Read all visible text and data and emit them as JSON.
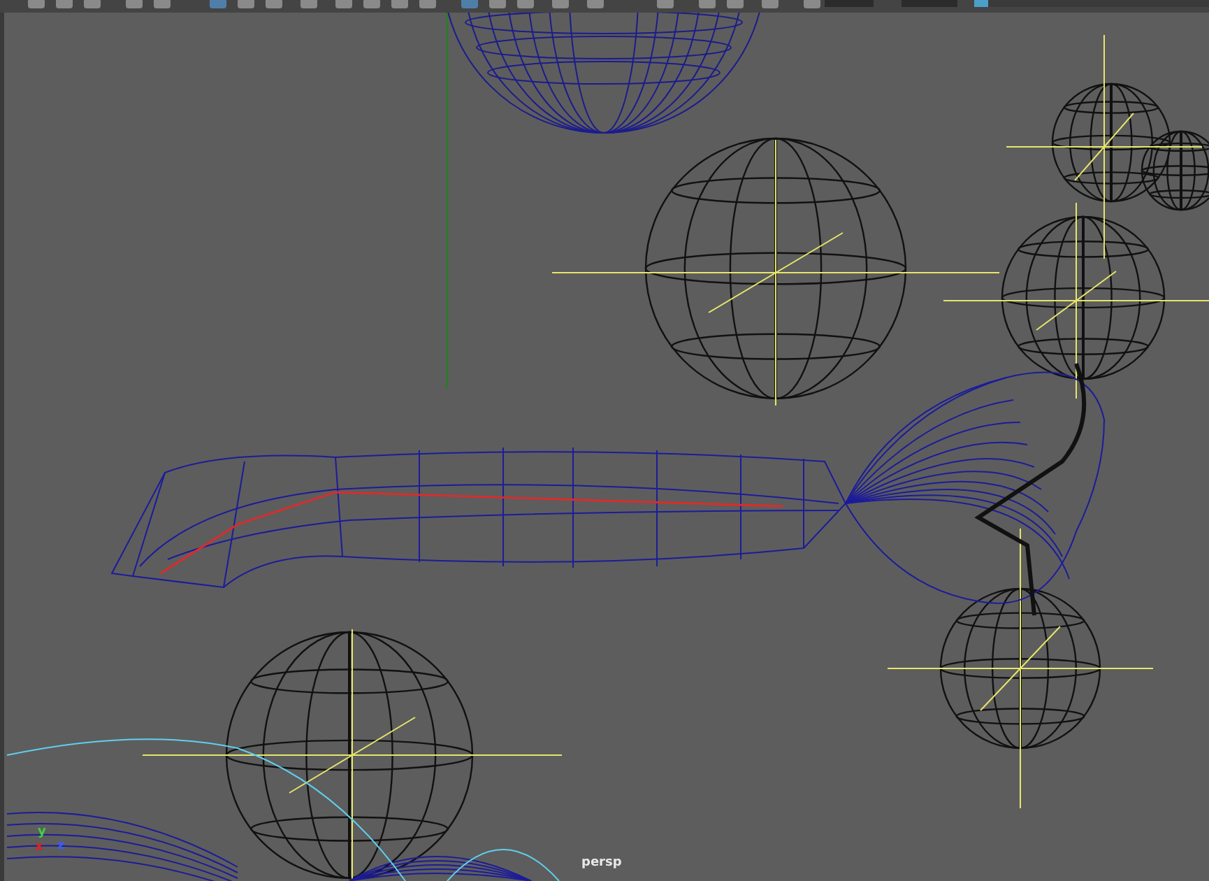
{
  "viewport": {
    "camera_label": "persp",
    "axis_gizmo": {
      "labels": [
        {
          "axis": "y",
          "color": "#3fd23f"
        },
        {
          "axis": "x",
          "color": "#e02020"
        },
        {
          "axis": "z",
          "color": "#3a5cff"
        }
      ]
    }
  }
}
